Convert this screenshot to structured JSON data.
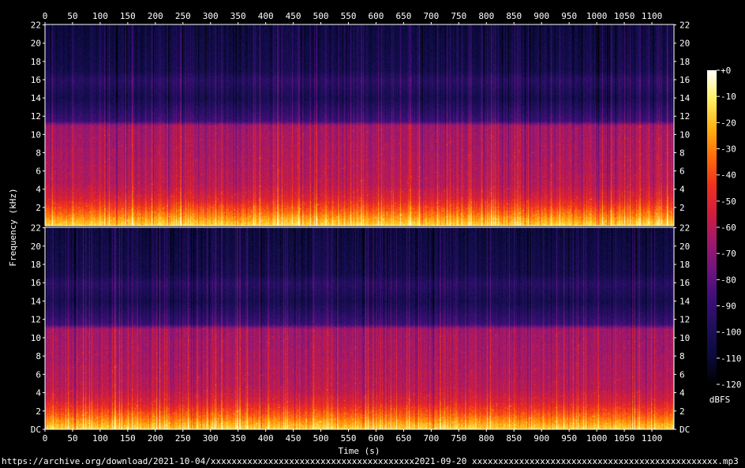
{
  "source_url": "https://archive.org/download/2021-10-04/xxxxxxxxxxxxxxxxxxxxxxxxxxxxxxxxxxxxxxx2021-09-20 xxxxxxxxxxxxxxxxxxxxxxxxxxxxxxxxxxxxxxxxxxxxxxx.mp3",
  "chart_data": {
    "type": "heatmap",
    "xlabel": "Time (s)",
    "ylabel": "Frequency (kHz)",
    "colorbar_label": "dBFS",
    "xlim": [
      0,
      1140
    ],
    "ylim": [
      0,
      22.05
    ],
    "x_ticks": [
      0,
      50,
      100,
      150,
      200,
      250,
      300,
      350,
      400,
      450,
      500,
      550,
      600,
      650,
      700,
      750,
      800,
      850,
      900,
      950,
      1000,
      1050,
      1100
    ],
    "y_ticks_top": [
      "22",
      "20",
      "18",
      "16",
      "14",
      "12",
      "10",
      "8",
      "6",
      "4",
      "2"
    ],
    "y_ticks_bottom": [
      "22",
      "20",
      "18",
      "16",
      "14",
      "12",
      "10",
      "8",
      "6",
      "4",
      "2",
      "DC"
    ],
    "y_tick_values": [
      22,
      20,
      18,
      16,
      14,
      12,
      10,
      8,
      6,
      4,
      2,
      0
    ],
    "colorbar_ticks": [
      "+0",
      "-10",
      "-20",
      "-30",
      "-40",
      "-50",
      "-60",
      "-70",
      "-80",
      "-90",
      "-100",
      "-110",
      "-120"
    ],
    "colorbar_values": [
      0,
      -10,
      -20,
      -30,
      -40,
      -50,
      -60,
      -70,
      -80,
      -90,
      -100,
      -110,
      -120
    ],
    "channels": [
      "left",
      "right"
    ],
    "colormap": [
      "#000000",
      "#0a0a3c",
      "#1e0f5a",
      "#3c0f78",
      "#6e147e",
      "#a0186c",
      "#d21e3c",
      "#f0321e",
      "#ff6e0a",
      "#ffb414",
      "#fff064",
      "#ffffff"
    ],
    "spectrum_profile_khz": [
      0,
      1.5,
      3,
      4.5,
      6,
      8,
      11,
      11.5,
      14,
      16,
      17,
      22
    ],
    "spectrum_profile_dbfs": [
      -15,
      -35,
      -52,
      -60,
      -62,
      -64,
      -66,
      -88,
      -102,
      -95,
      -103,
      -108
    ]
  }
}
